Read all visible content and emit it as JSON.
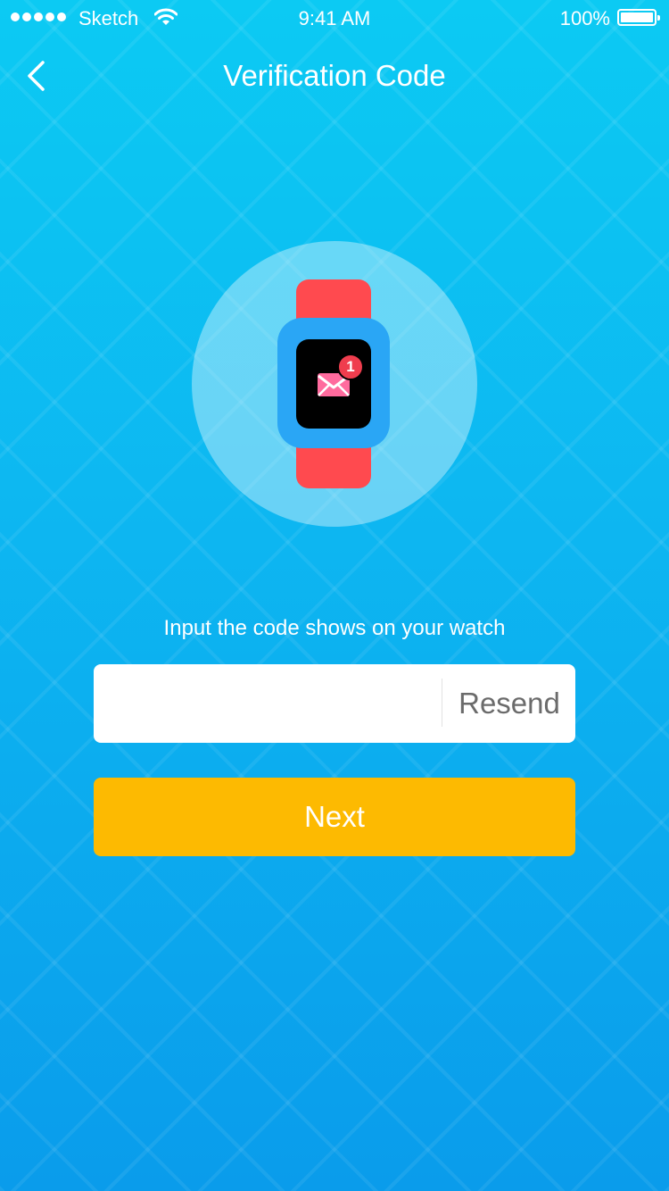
{
  "status_bar": {
    "carrier": "Sketch",
    "time": "9:41 AM",
    "battery": "100%",
    "icons": [
      "signal-dots-icon",
      "wifi-icon",
      "battery-icon"
    ]
  },
  "nav": {
    "title": "Verification Code",
    "back_icon": "chevron-left-icon"
  },
  "illustration": {
    "icon": "smartwatch-icon",
    "notification_icon": "envelope-icon",
    "badge_count": "1",
    "colors": {
      "strap": "#ff4a4f",
      "case": "#2aa6f5",
      "screen": "#000000",
      "envelope": "#ff6b9e",
      "badge": "#ef3d4e"
    }
  },
  "form": {
    "instruction": "Input the code shows on your watch",
    "code_value": "",
    "code_placeholder": "",
    "resend_label": "Resend",
    "next_label": "Next"
  },
  "colors": {
    "background_top": "#0ccaf3",
    "background_bottom": "#0a9ceb",
    "primary_button": "#fdba01",
    "field_background": "#ffffff",
    "resend_text": "#6b6b6b"
  }
}
